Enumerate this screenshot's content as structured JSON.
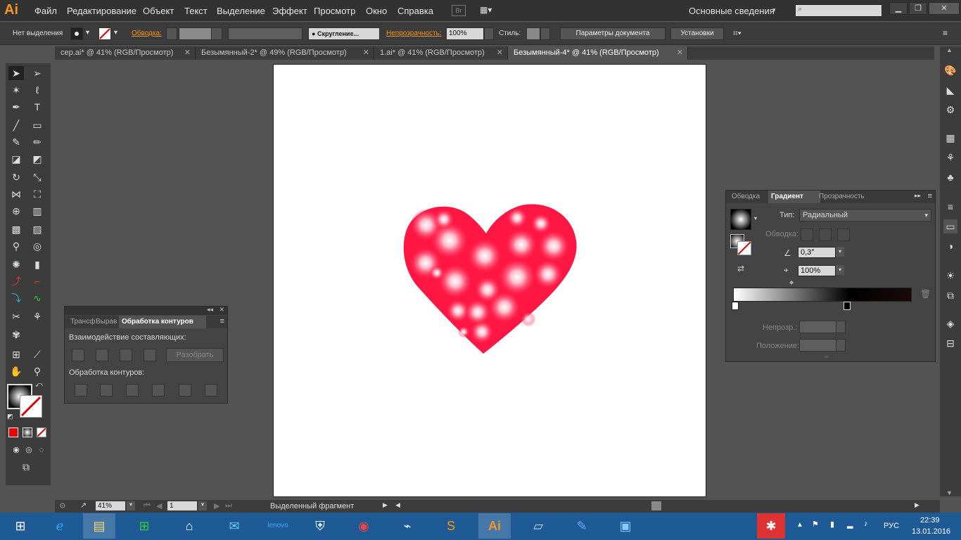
{
  "app": {
    "logo": "Ai"
  },
  "menu": {
    "items": [
      "Файл",
      "Редактирование",
      "Объект",
      "Текст",
      "Выделение",
      "Эффект",
      "Просмотр",
      "Окно",
      "Справка"
    ],
    "br": "Br",
    "workspace": "Основные сведения"
  },
  "controlbar": {
    "selection": "Нет выделения",
    "stroke_label": "Обводка:",
    "round_label": "Скругление...",
    "opacity_label": "Непрозрачность:",
    "opacity_value": "100%",
    "style_label": "Стиль:",
    "doc_params": "Параметры документа",
    "settings": "Установки"
  },
  "tabs": [
    {
      "label": "сер.ai* @ 41% (RGB/Просмотр)"
    },
    {
      "label": "Безымянный-2* @ 49% (RGB/Просмотр)"
    },
    {
      "label": "1.ai* @ 41% (RGB/Просмотр)"
    },
    {
      "label": "Безымянный-4* @ 41% (RGB/Просмотр)"
    }
  ],
  "pathfinder": {
    "tabs": [
      "Трансф",
      "Вырав",
      "Обработка контуров"
    ],
    "shape_modes": "Взаимодействие составляющих:",
    "expand": "Разобрать",
    "pathfinders": "Обработка контуров:"
  },
  "gradient": {
    "tabs": [
      "Обводка",
      "Градиент",
      "Прозрачность"
    ],
    "type_label": "Тип:",
    "type_value": "Радиальный",
    "stroke_label": "Обводка:",
    "angle": "0,3°",
    "aspect": "100%",
    "opacity_label": "Непрозр.:",
    "location_label": "Положение:"
  },
  "status": {
    "zoom": "41%",
    "page": "1",
    "info": "Выделенный фрагмент"
  },
  "taskbar": {
    "lang": "РУС",
    "time": "22:39",
    "date": "13.01.2016"
  },
  "colors": {
    "heart": "#ff1744",
    "accent": "#f7941e"
  }
}
